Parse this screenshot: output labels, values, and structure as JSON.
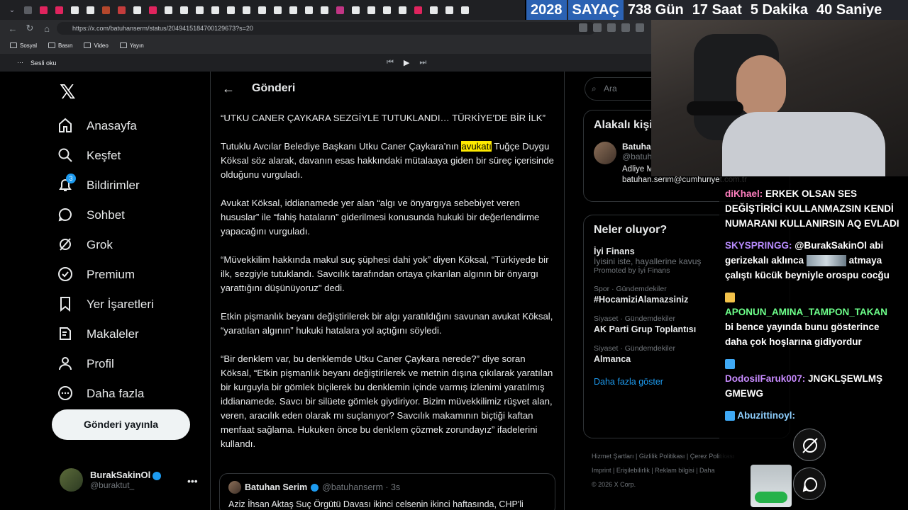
{
  "browser": {
    "url": "https://x.com/batuhanserm/status/2049415184700129673?s=20",
    "bookmarks": [
      "Sosyal",
      "Basın",
      "Video",
      "Yayın"
    ],
    "read_aloud": "Sesli oku"
  },
  "counter": {
    "year": "2028",
    "label": "SAYAÇ",
    "days": "738 Gün",
    "hours": "17 Saat",
    "minutes": "5 Dakika",
    "seconds": "40 Saniye"
  },
  "sidebar": {
    "items": [
      {
        "label": "Anasayfa"
      },
      {
        "label": "Keşfet"
      },
      {
        "label": "Bildirimler",
        "badge": "3"
      },
      {
        "label": "Sohbet"
      },
      {
        "label": "Grok"
      },
      {
        "label": "Premium"
      },
      {
        "label": "Yer İşaretleri"
      },
      {
        "label": "Makaleler"
      },
      {
        "label": "Profil"
      },
      {
        "label": "Daha fazla"
      }
    ],
    "post_button": "Gönderi yayınla",
    "account_name": "BurakSakinOl",
    "account_handle": "@buraktut_"
  },
  "main": {
    "title": "Gönderi",
    "paragraphs": [
      "“UTKU CANER ÇAYKARA SEZGİYLE TUTUKLANDI… TÜRKİYE’DE BİR İLK”",
      "Tutuklu Avcılar Belediye Başkanı Utku Caner Çaykara’nın",
      "avukatı",
      "Tuğçe Duygu Köksal söz alarak, davanın esas hakkındaki mütalaaya giden bir süreç içerisinde olduğunu vurguladı.",
      "Avukat Köksal, iddianamede yer alan “algı ve önyargıya sebebiyet veren hususlar” ile “fahiş hataların” giderilmesi konusunda hukuki bir değerlendirme yapacağını vurguladı.",
      "“Müvekkilim hakkında makul suç şüphesi dahi yok” diyen Köksal, “Türkiyede bir ilk, sezgiyle tutuklandı. Savcılık tarafından ortaya çıkarılan algının bir önyargı yarattığını düşünüyoruz\" dedi.",
      "Etkin pişmanlık beyanı değiştirilerek bir algı yaratıldığını savunan avukat Köksal, “yaratılan algının” hukuki hatalara yol açtığını söyledi.",
      "“Bir denklem var, bu denklemde Utku Caner Çaykara nerede?” diye soran Köksal, “Etkin pişmanlık beyanı değiştirilerek ve metnin dışına çıkılarak yaratılan bir kurguyla bir gömlek biçilerek bu denklemin içinde varmış izlenimi yaratılmış iddianamede. Savcı bir silüete gömlek giydiriyor. Bizim müvekkilimiz rüşvet alan, veren, aracılık eden olarak mı suçlanıyor? Savcılık makamının biçtiği kaftan menfaat sağlama. Hukuken önce bu denklem çözmek zorundayız” ifadelerini kullandı."
    ],
    "quote": {
      "name": "Batuhan Serim",
      "handle": "@batuhanserm · 3s",
      "text": "Aziz İhsan Aktaş Suç Örgütü Davası ikinci celsenin ikinci haftasında, CHP'li"
    }
  },
  "right": {
    "search_placeholder": "Ara",
    "related_title": "Alakalı kişi",
    "person_name": "Batuhan",
    "person_handle": "@batuh",
    "person_bio1": "Adliye Muhabiri / Cumhuriyet Gazetesi",
    "person_bio2": "batuhan.serim@cumhuriyet.com.tr",
    "trends_title": "Neler oluyor?",
    "trends": [
      {
        "cat": "",
        "title": "İyi Finans",
        "desc": "İyisini iste, hayallerine kavuş",
        "promo": "Promoted by İyi Finans"
      },
      {
        "cat": "Spor · Gündemdekiler",
        "title": "#HocamiziAlamazsiniz"
      },
      {
        "cat": "Siyaset · Gündemdekiler",
        "title": "AK Parti Grup Toplantısı"
      },
      {
        "cat": "Siyaset · Gündemdekiler",
        "title": "Almanca"
      }
    ],
    "show_more": "Daha fazla göster",
    "footer1": "Hizmet Şartları | Gizlilik Politikası | Çerez Politikası",
    "footer2": "Imprint | Erişilebilirlik | Reklam bilgisi | Daha",
    "footer3": "© 2026 X Corp."
  },
  "chat": [
    {
      "user": "diKhael:",
      "text": "ERKEK OLSAN SES DEĞİŞTİRİCİ KULLANMAZSIN KENDİ NUMARANI KULLANIRSIN AQ EVLADI"
    },
    {
      "user": "SKYSPRINGG:",
      "text": "@BurakSakinOl abi gerizekalı aklınca",
      "text2": "atmaya çalıştı kücük beyniyle orospu cocğu"
    },
    {
      "user": "APONUN_AMINA_TAMPON_TAKAN",
      "text": "bi bence yayında bunu gösterince daha çok hoşlarına gidiyordur"
    },
    {
      "user": "DodosilFaruk007:",
      "text": "JNGKLŞEWLMŞ GMEWG"
    },
    {
      "user": "Abuzittinoyl:",
      "text": ""
    }
  ]
}
